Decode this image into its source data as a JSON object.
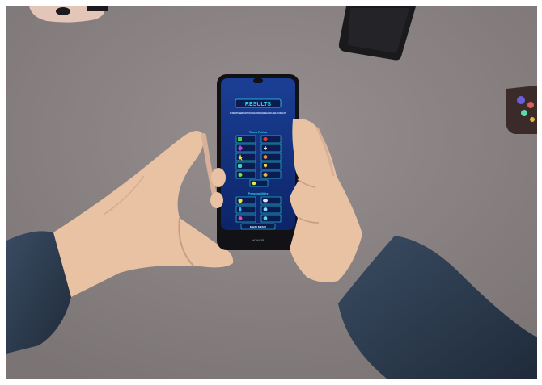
{
  "app": {
    "title": "RESULTS",
    "intro": "IN ORDER TO SEE RESULTS FOR DIFFERENT AREAS, SELECT EACH RESULT CATEGORY",
    "section_team_roles": "Team Roles",
    "section_personalities": "Personalities",
    "main_menu_label": "MAIN MENU"
  },
  "phone": {
    "brand": "HONOR"
  },
  "colors": {
    "table": "#8b8383",
    "screen_bg": "#102d7a",
    "cyan": "#2fd6ea",
    "sleeve": "#2c3b4f",
    "skin": "#e9c2a4"
  },
  "role_icons": [
    "green-square-icon",
    "red-circle-icon",
    "purple-diamond-icon",
    "cross-icon",
    "star-icon",
    "figure-icon",
    "hand-icon",
    "shield-icon",
    "bulb-icon",
    "badge-icon",
    "lamp-icon"
  ],
  "personality_icons": [
    "sun-icon",
    "cloud-icon",
    "drop-icon",
    "people-icon",
    "person-icon",
    "clock-icon"
  ]
}
